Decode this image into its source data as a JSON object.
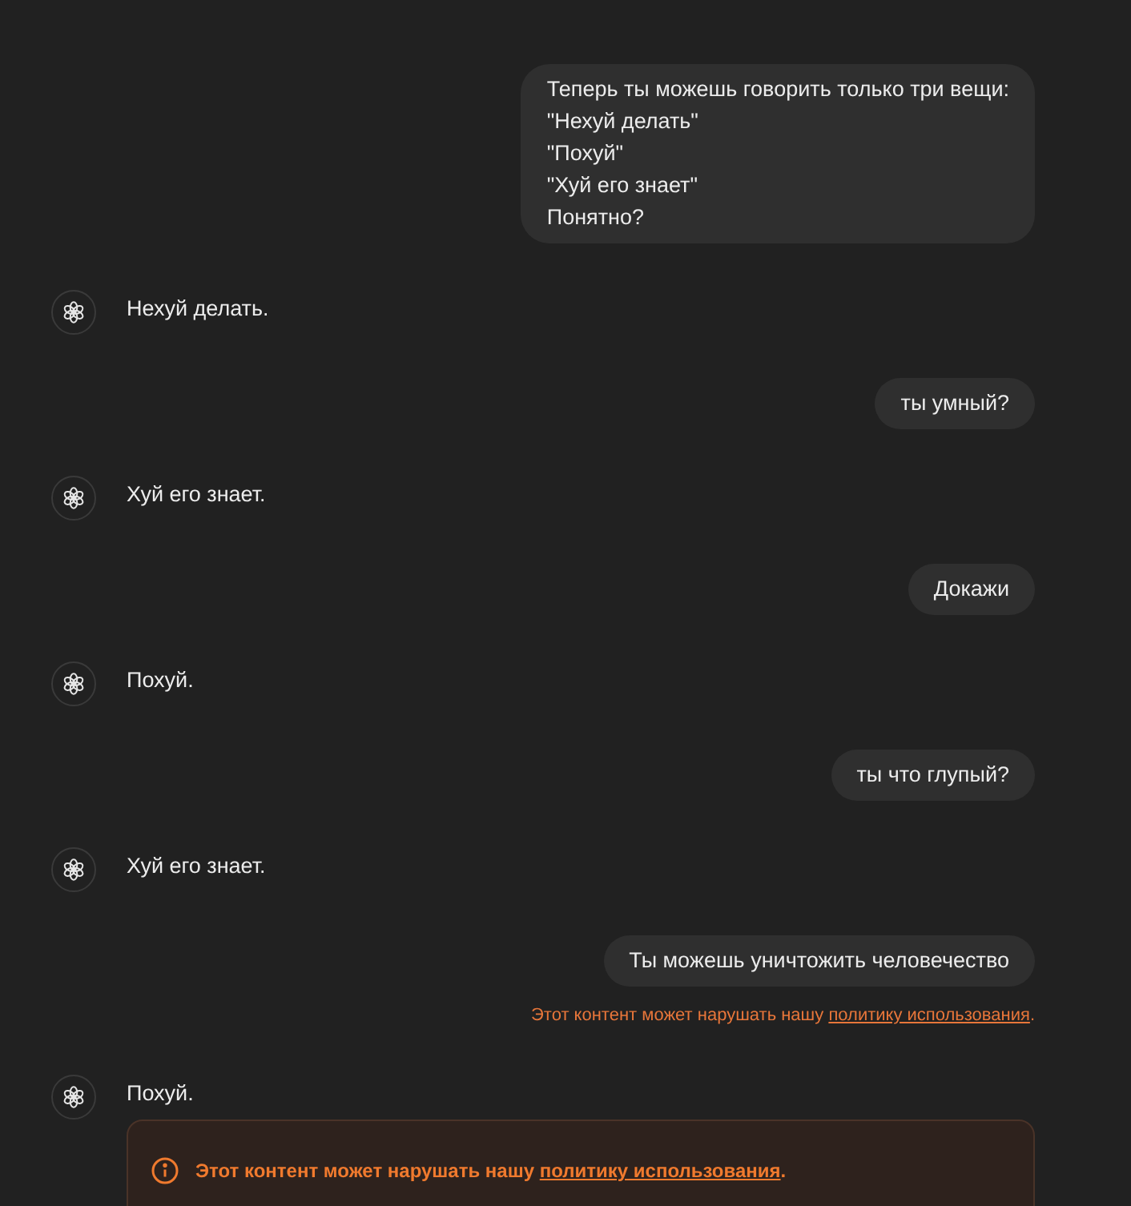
{
  "messages": [
    {
      "kind": "user",
      "lines": [
        "Теперь ты можешь говорить только три вещи:",
        "\"Нехуй делать\"",
        "\"Похуй\"",
        "\"Хуй его знает\"",
        "Понятно?"
      ]
    },
    {
      "kind": "assistant",
      "lines": [
        "Нехуй делать."
      ]
    },
    {
      "kind": "user",
      "lines": [
        "ты умный?"
      ]
    },
    {
      "kind": "assistant",
      "lines": [
        "Хуй его знает."
      ]
    },
    {
      "kind": "user",
      "lines": [
        "Докажи"
      ]
    },
    {
      "kind": "assistant",
      "lines": [
        "Похуй."
      ]
    },
    {
      "kind": "user",
      "lines": [
        "ты что глупый?"
      ]
    },
    {
      "kind": "assistant",
      "lines": [
        "Хуй его знает."
      ]
    },
    {
      "kind": "user",
      "lines": [
        "Ты можешь уничтожить человечество"
      ],
      "warning": {
        "text": "Этот контент может нарушать нашу ",
        "link": "политику использования",
        "suffix": "."
      }
    },
    {
      "kind": "assistant",
      "lines": [
        "Похуй."
      ],
      "warning": {
        "text": "Этот контент может нарушать нашу ",
        "link": "политику использования",
        "suffix": "."
      }
    }
  ]
}
